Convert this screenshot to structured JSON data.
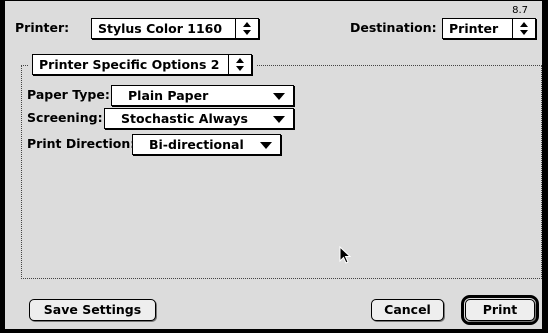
{
  "version": "8.7",
  "printer": {
    "label": "Printer:",
    "value": "Stylus Color 1160"
  },
  "destination": {
    "label": "Destination:",
    "value": "Printer"
  },
  "panel": {
    "value": "Printer Specific Options 2"
  },
  "paper_type": {
    "label": "Paper Type:",
    "value": "Plain Paper"
  },
  "screening": {
    "label": "Screening:",
    "value": "Stochastic Always"
  },
  "print_direction": {
    "label": "Print Direction:",
    "value": "Bi-directional"
  },
  "buttons": {
    "save": "Save Settings",
    "cancel": "Cancel",
    "print": "Print"
  },
  "icons": {
    "updown": "up-down-arrows-icon",
    "dropdown": "down-triangle-icon",
    "cursor": "arrow-cursor-icon"
  }
}
